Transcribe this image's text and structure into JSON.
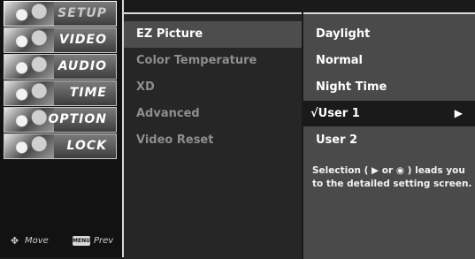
{
  "sidebar": {
    "categories": [
      {
        "label": "SETUP"
      },
      {
        "label": "VIDEO"
      },
      {
        "label": "AUDIO"
      },
      {
        "label": "TIME"
      },
      {
        "label": "OPTION"
      },
      {
        "label": "LOCK"
      }
    ],
    "active_index": 0,
    "hints": {
      "move_label": "Move",
      "menu_key": "MENU",
      "prev_label": "Prev"
    }
  },
  "options": {
    "items": [
      {
        "label": "EZ Picture"
      },
      {
        "label": "Color Temperature"
      },
      {
        "label": "XD"
      },
      {
        "label": "Advanced"
      },
      {
        "label": "Video Reset"
      }
    ],
    "active_index": 0
  },
  "suboptions": {
    "items": [
      {
        "label": "Daylight"
      },
      {
        "label": "Normal"
      },
      {
        "label": "Night Time"
      },
      {
        "label": "User 1"
      },
      {
        "label": "User 2"
      }
    ],
    "selected_index": 3,
    "checkmark": "√",
    "arrow": "▶",
    "help_text": "Selection ( ▶ or ◉ ) leads you to the detailed setting screen."
  },
  "colors": {
    "panel_mid": "#262626",
    "panel_right": "#4a4a4a",
    "selected_row": "#1a1a1a",
    "text": "#ffffff",
    "dimmed_text": "#8e8e8e"
  }
}
